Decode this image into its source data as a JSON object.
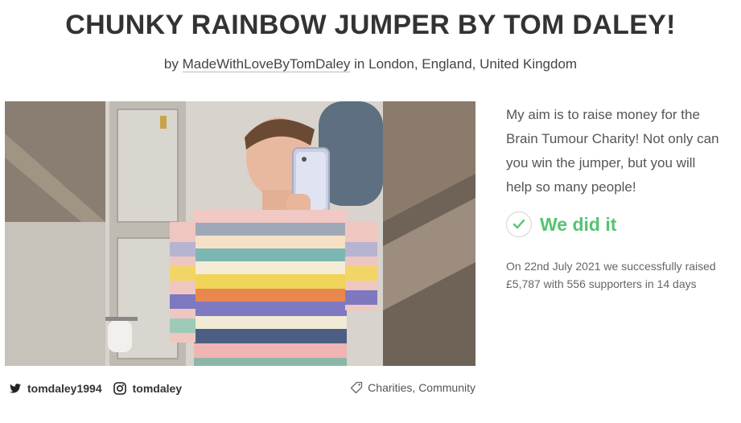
{
  "page": {
    "title": "CHUNKY RAINBOW JUMPER BY TOM DALEY!",
    "by_prefix": "by",
    "organiser": "MadeWithLoveByTomDaley",
    "location": "in London, England, United Kingdom"
  },
  "story": {
    "text": "My aim is to raise money for the Brain Tumour Charity! Not only can you win the jumper, but you will help so many people!"
  },
  "status": {
    "label": "We did it",
    "icon": "check-icon",
    "color": "#55c473",
    "summary": "On 22nd July 2021 we successfully raised £5,787 with 556 supporters in 14 days"
  },
  "social": {
    "twitter": {
      "icon": "twitter-icon",
      "handle": "tomdaley1994"
    },
    "instagram": {
      "icon": "instagram-icon",
      "handle": "tomdaley"
    }
  },
  "tags": {
    "icon": "tag-icon",
    "text": "Charities, Community"
  }
}
